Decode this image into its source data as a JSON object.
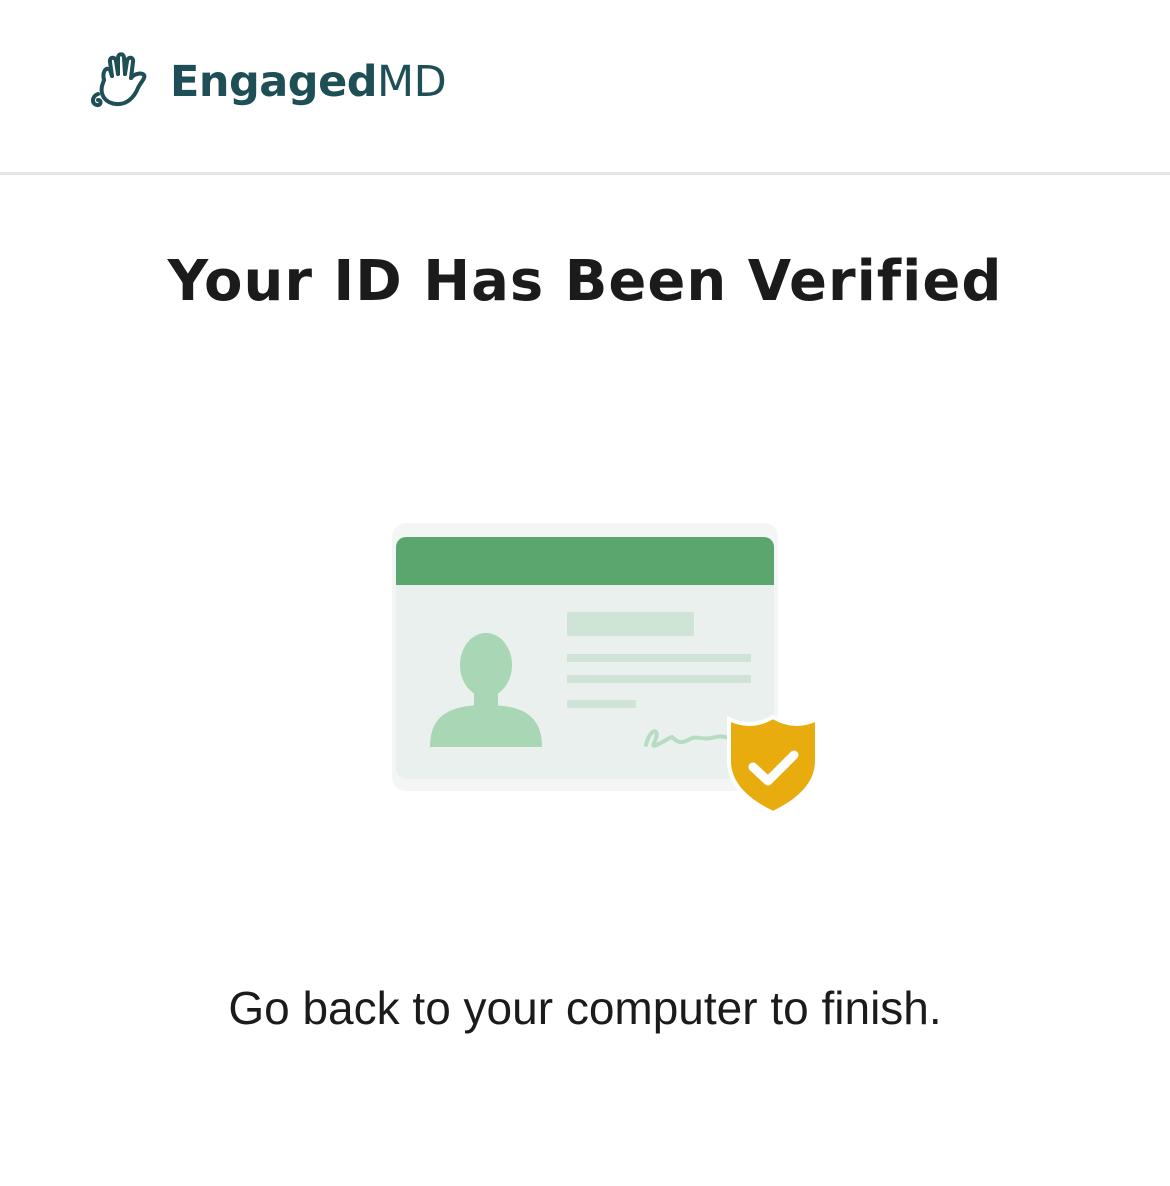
{
  "header": {
    "brand_bold": "Engaged",
    "brand_light": "MD",
    "logo_icon": "waving-hand-icon",
    "brand_color": "#1f4f56"
  },
  "main": {
    "title": "Your ID Has Been Verified",
    "message": "Go back to your computer to finish.",
    "illustration": {
      "icon": "id-card-verified-icon",
      "card_header_color": "#5aa66e",
      "card_body_color": "#e9f0ee",
      "badge_color": "#e9ac0e"
    }
  }
}
